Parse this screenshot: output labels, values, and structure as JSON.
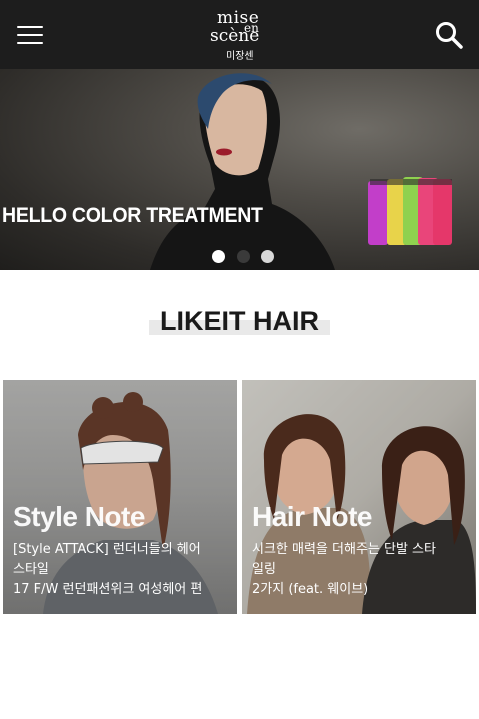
{
  "header": {
    "menu_icon": "hamburger-menu-icon",
    "logo_lines": [
      "mise",
      "en",
      "scène",
      "미장센"
    ],
    "search_icon": "search-icon",
    "bg_color": "#1d1d1d"
  },
  "banner": {
    "title": "HELLO COLOR TREATMENT",
    "dots": [
      {
        "state": "active",
        "color": "#ffffff"
      },
      {
        "state": "inactive",
        "color": "#3a3a3a"
      },
      {
        "state": "inactive",
        "color": "#d8d8d8"
      }
    ]
  },
  "section": {
    "title": "LIKEIT HAIR"
  },
  "cards": [
    {
      "category": "Style Note",
      "lines": [
        "[Style ATTACK] 런더너들의 헤어",
        "스타일",
        "17 F/W 런던패션위크 여성헤어 편"
      ]
    },
    {
      "category": "Hair Note",
      "lines": [
        "시크한 매력을 더해주는 단발 스타",
        "일링",
        "2가지 (feat. 웨이브)"
      ]
    }
  ]
}
